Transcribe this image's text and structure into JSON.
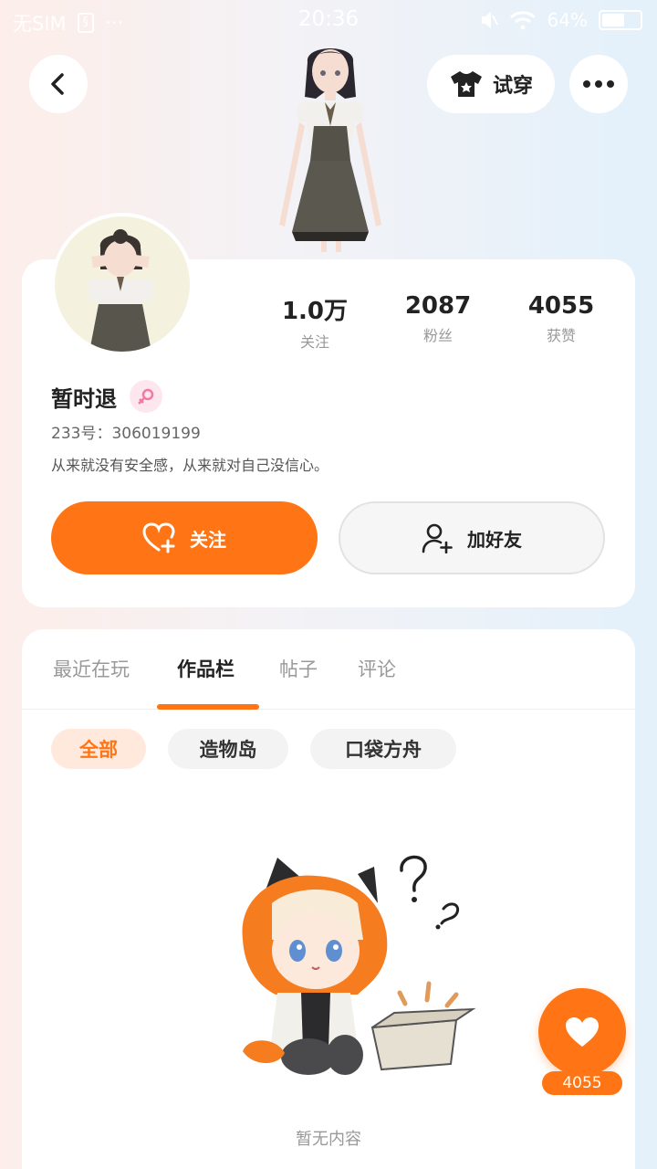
{
  "status_bar": {
    "carrier": "无SIM",
    "sim_badge": "§",
    "extra": "···",
    "time": "20:36",
    "battery": "64%",
    "battery_level": 0.64,
    "icons": [
      "mute-icon",
      "wifi-icon",
      "battery-icon"
    ]
  },
  "header": {
    "try_on_label": "试穿",
    "icons": [
      "back-arrow-icon",
      "tshirt-icon",
      "more-dots-icon"
    ]
  },
  "profile": {
    "stats": [
      {
        "value": "1.0万",
        "label": "关注"
      },
      {
        "value": "2087",
        "label": "粉丝"
      },
      {
        "value": "4055",
        "label": "获赞"
      }
    ],
    "username": "暂时退",
    "gender": "female",
    "user_id": "233号：306019199",
    "bio": "从来就没有安全感，从来就对自己没信心。",
    "follow_label": "关注",
    "add_friend_label": "加好友"
  },
  "tabs": [
    {
      "label": "最近在玩",
      "active": false
    },
    {
      "label": "作品栏",
      "active": true
    },
    {
      "label": "帖子",
      "active": false
    },
    {
      "label": "评论",
      "active": false
    }
  ],
  "chips": [
    {
      "label": "全部",
      "active": true
    },
    {
      "label": "造物岛",
      "active": false
    },
    {
      "label": "口袋方舟",
      "active": false
    }
  ],
  "empty_state": {
    "text": "暂无内容"
  },
  "floating_like": {
    "count": "4055"
  },
  "colors": {
    "accent": "#ff7515",
    "accent_soft": "#ffe9dc",
    "gender_badge": "#f27aa0"
  }
}
